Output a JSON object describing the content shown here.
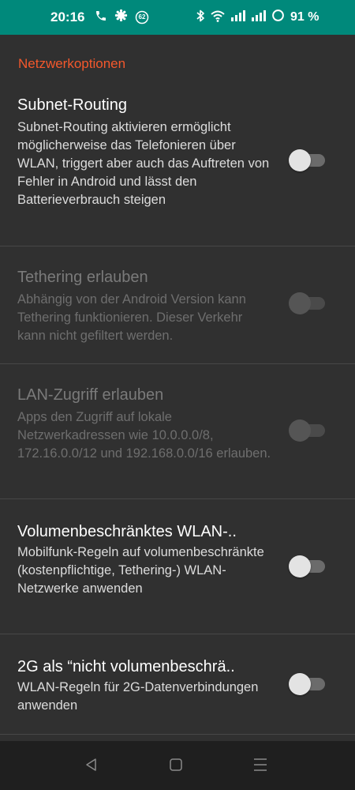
{
  "status_bar": {
    "time": "20:16",
    "notification_badge": "62",
    "battery_percent": "91 %",
    "icons_left": [
      "phone-icon",
      "gear-badge-icon",
      "notification-badge-icon"
    ],
    "icons_right": [
      "bluetooth-icon",
      "wifi-icon",
      "signal-icon",
      "signal-icon",
      "battery-ring-icon"
    ],
    "background_color": "#00897b"
  },
  "section": {
    "header": "Netzwerkoptionen",
    "header_color": "#f4582c"
  },
  "preferences": [
    {
      "title": "Subnet-Routing",
      "summary": "Subnet-Routing aktivieren ermöglicht möglicherweise das Telefonieren über WLAN, triggert aber auch das Auftreten von Fehler in Android und lässt den Batterieverbrauch steigen",
      "enabled": true,
      "checked": false
    },
    {
      "title": "Tethering erlauben",
      "summary": "Abhängig von der Android Version kann Tethering funktionieren. Dieser Verkehr kann nicht gefiltert werden.",
      "enabled": false,
      "checked": false
    },
    {
      "title": "LAN-Zugriff erlauben",
      "summary": "Apps den Zugriff auf lokale Netzwerkadressen wie 10.0.0.0/8, 172.16.0.0/12 und 192.168.0.0/16 erlauben.",
      "enabled": false,
      "checked": false
    },
    {
      "title": "Volumenbeschränktes WLAN-..",
      "summary": "Mobilfunk-Regeln auf volumenbeschränkte (kostenpflichtige, Tethering-) WLAN-Netzwerke anwenden",
      "enabled": true,
      "checked": false
    },
    {
      "title": "2G als “nicht volumenbeschrä..",
      "summary": "WLAN-Regeln für 2G-Datenverbindungen anwenden",
      "enabled": true,
      "checked": false
    }
  ],
  "nav_bar": {
    "buttons": [
      "back-icon",
      "home-icon",
      "recents-icon"
    ]
  }
}
